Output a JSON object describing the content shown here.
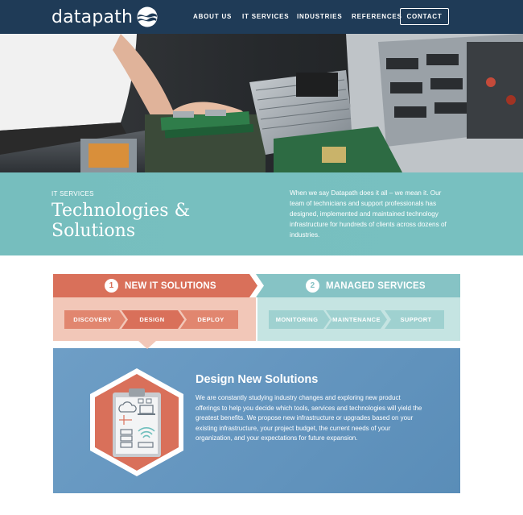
{
  "nav": {
    "logo": "datapath",
    "links": [
      "ABOUT US",
      "IT SERVICES",
      "INDUSTRIES",
      "REFERENCES"
    ],
    "contact": "CONTACT"
  },
  "hero": {
    "eyebrow": "IT SERVICES",
    "title": "Technologies & Solutions",
    "intro": "When we say Datapath does it all – we mean it. Our team of technicians and support professionals has designed, implemented and maintained technology infrastructure for hundreds of clients across dozens of industries."
  },
  "tabs": [
    {
      "number": "1",
      "label": "NEW IT SOLUTIONS",
      "steps": [
        "DISCOVERY",
        "DESIGN",
        "DEPLOY"
      ],
      "active_step": "DESIGN"
    },
    {
      "number": "2",
      "label": "MANAGED SERVICES",
      "steps": [
        "MONITORING",
        "MAINTENANCE",
        "SUPPORT"
      ]
    }
  ],
  "content": {
    "title": "Design New Solutions",
    "body": "We are constantly studying industry changes and exploring new product offerings to help you decide which tools, services and technologies will yield the greatest benefits. We propose new infrastructure or upgrades based on your existing infrastructure, your project budget, the current needs of your organization, and your expectations for future expansion."
  },
  "colors": {
    "nav_bg": "#1f3b57",
    "teal": "#78c0c1",
    "coral": "#d9705a",
    "coral_step": "#e1866f",
    "coral_light": "#f2c7b8",
    "teal_tab": "#86c3c5",
    "teal_light": "#c5e4e2",
    "blue": "#6e9ec6"
  },
  "icons": [
    "datapath-wave-logo",
    "clipboard-diagram-icon",
    "cloud-icon",
    "laptop-icon",
    "wifi-icon",
    "server-icon"
  ]
}
